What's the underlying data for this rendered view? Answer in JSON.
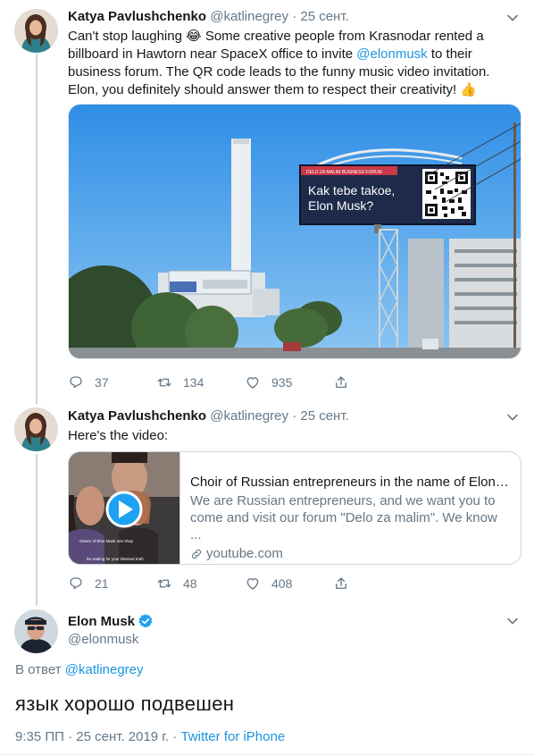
{
  "thread": {
    "tweet1": {
      "author_name": "Katya Pavlushchenko",
      "author_handle": "@katlinegrey",
      "separator": "·",
      "time": "25 сент.",
      "text_before_emoji": "Can't stop laughing ",
      "emoji_laugh": "😂",
      "text_part2": " Some creative people from Krasnodar rented a billboard in Hawtorn near SpaceX office to invite ",
      "mention": "@elonmusk",
      "text_part3": " to their business forum. The QR code leads to the funny music video invitation. Elon, you definitely should answer them to respect their creativity! ",
      "emoji_thumb": "👍",
      "billboard_header": "DELO ZA MALIM BUSINESS FORUM",
      "billboard_line1": "Kak tebe takoe,",
      "billboard_line2": "Elon Musk?",
      "replies": "37",
      "retweets": "134",
      "likes": "935"
    },
    "tweet2": {
      "author_name": "Katya Pavlushchenko",
      "author_handle": "@katlinegrey",
      "separator": "·",
      "time": "25 сент.",
      "text": "Here's the video:",
      "card": {
        "title": "Choir of Russian entrepreneurs in the name of Elon ...",
        "description": "We are Russian entrepreneurs, and we want you to come and visit our forum \"Delo za malim\". We know ...",
        "domain": "youtube.com",
        "thumb_caption_top": "Owner of Elon Musk see shop",
        "thumb_caption_bottom": "be waiting for your blessed truth"
      },
      "replies": "21",
      "retweets": "48",
      "likes": "408"
    },
    "main_tweet": {
      "author_name": "Elon Musk",
      "author_handle": "@elonmusk",
      "reply_prefix": "В ответ",
      "reply_to": "@katlinegrey",
      "text": "язык хорошо подвешен",
      "timestamp": "9:35 ПП · 25 сент. 2019 г. · ",
      "source": "Twitter for iPhone"
    }
  },
  "icons": {
    "reply": "reply-icon",
    "retweet": "retweet-icon",
    "like": "heart-icon",
    "share": "share-icon",
    "caret": "chevron-down-icon",
    "verified": "verified-badge-icon",
    "play": "play-icon",
    "link": "link-icon"
  },
  "colors": {
    "link": "#1b95e0",
    "secondary_text": "#657786",
    "primary_text": "#14171a",
    "verified": "#1da1f2"
  }
}
